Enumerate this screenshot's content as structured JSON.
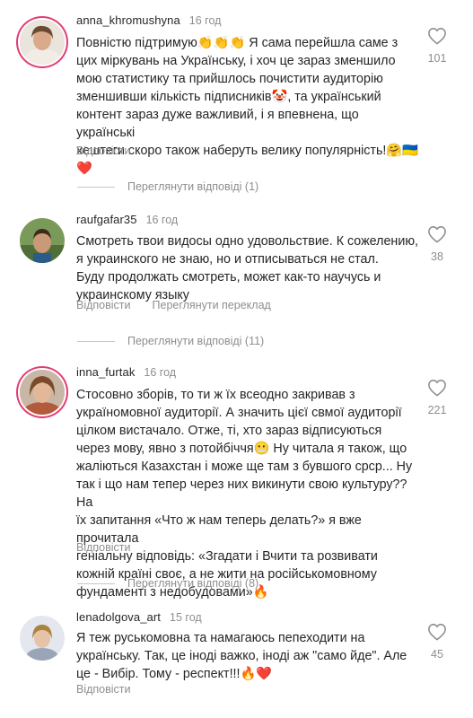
{
  "comments": [
    {
      "username": "anna_khromushyna",
      "time": "16 год",
      "text": "Повністю підтримую👏👏👏 Я сама перейшла саме з\nцих міркувань на Українську, і хоч це зараз зменшило\nмою статистику та прийшлось почистити аудиторію\nзменшивши кількість підписників🤡, та український\nконтент зараз дуже важливий, і я впевнена, що українські\nхештеги скоро також наберуть велику популярність!🤗🇺🇦",
      "text_end": "❤️",
      "reply_label": "Відповісти",
      "likes": "101",
      "view_replies": "Переглянути відповіді (1)"
    },
    {
      "username": "raufgafar35",
      "time": "16 год",
      "text": "Смотреть твои видосы одно удовольствие. К сожелению,\nя украинского не знаю, но и отписываться не стал.\nБуду продолжать смотреть, может как-то научусь и\nукраинскому языку",
      "reply_label": "Відповісти",
      "translate_label": "Переглянути переклад",
      "likes": "38",
      "view_replies": "Переглянути відповіді (11)"
    },
    {
      "username": "inna_furtak",
      "time": "16 год",
      "text": "Стосовно зборів, то ти ж їх всеодно закривав з\nукраїномовної аудиторії. А значить цієї свмої аудиторії\nцілком вистачало. Отже, ті, хто зараз відписуються\nчерез мову, явно з потойбіччя😬 Ну читала я також, що\nжаліються Казахстан і може ще там з бувшого срср... Ну\nтак і що нам тепер через них викинути свою культуру?? На\nїх запитання «Что ж нам теперь делать?» я вже прочитала\nгеніальну відповідь: «Згадати і Вчити та розвивати\nкожній країні своє, а не жити на російськомовному\nфундаменті з недобудовами»🔥",
      "reply_label": "Відповісти",
      "likes": "221",
      "view_replies": "Переглянути відповіді (8)"
    },
    {
      "username": "lenadolgova_art",
      "time": "15 год",
      "text": "Я теж руськомовна та намагаюсь пепеходити на\nукраїнську. Так, це іноді важко, іноді аж \"само йде\". Але\nце - Вибір. Тому - респект!!!🔥",
      "text_end": "❤️",
      "reply_label": "Відповісти",
      "likes": "45"
    }
  ],
  "icons": {
    "like": "heart-outline-icon"
  },
  "colors": {
    "text": "#262626",
    "secondary": "#8e8e8e",
    "story_ring": "#e13c74"
  }
}
